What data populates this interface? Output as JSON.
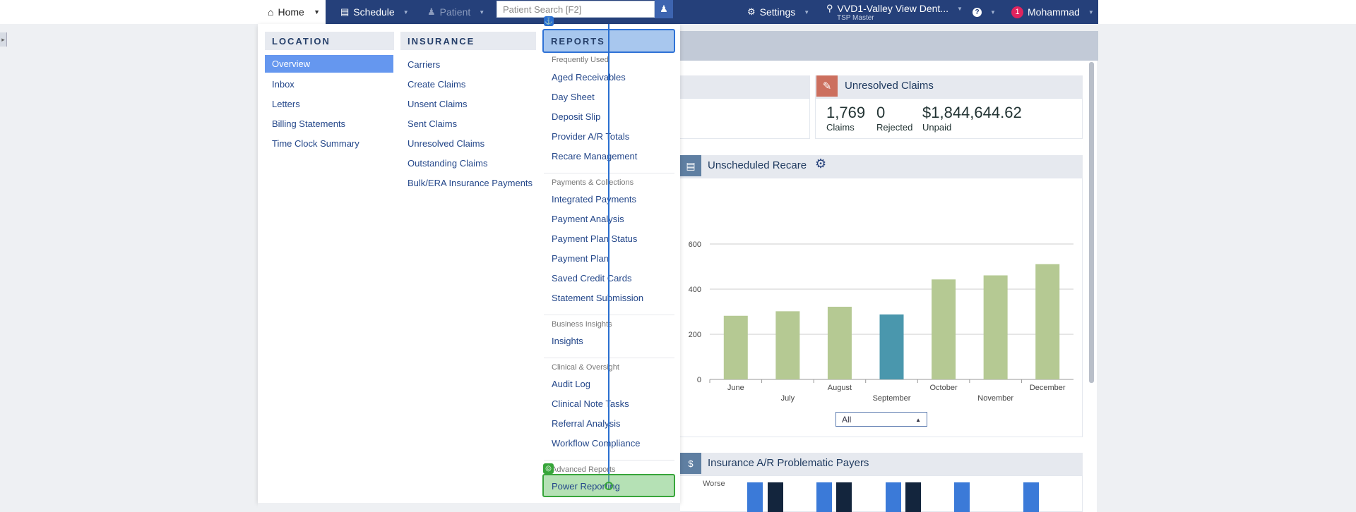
{
  "topbar": {
    "home_label": "Home",
    "schedule_label": "Schedule",
    "patient_label": "Patient",
    "search_placeholder": "Patient Search [F2]",
    "settings_label": "Settings",
    "location_label": "VVD1-Valley View Dent...",
    "location_sub": "TSP Master",
    "notification_count": "1",
    "user_label": "Mohammad"
  },
  "menu": {
    "location": {
      "header": "LOCATION",
      "items": [
        "Overview",
        "Inbox",
        "Letters",
        "Billing Statements",
        "Time Clock Summary"
      ]
    },
    "insurance": {
      "header": "INSURANCE",
      "items": [
        "Carriers",
        "Create Claims",
        "Unsent Claims",
        "Sent Claims",
        "Unresolved Claims",
        "Outstanding Claims",
        "Bulk/ERA Insurance Payments"
      ]
    },
    "reports": {
      "header": "REPORTS",
      "sections": [
        {
          "title": "Frequently Used",
          "items": [
            "Aged Receivables",
            "Day Sheet",
            "Deposit Slip",
            "Provider A/R Totals",
            "Recare Management"
          ]
        },
        {
          "title": "Payments & Collections",
          "items": [
            "Integrated Payments",
            "Payment Analysis",
            "Payment Plan Status",
            "Payment Plan",
            "Saved Credit Cards",
            "Statement Submission"
          ]
        },
        {
          "title": "Business Insights",
          "items": [
            "Insights"
          ]
        },
        {
          "title": "Clinical & Oversight",
          "items": [
            "Audit Log",
            "Clinical Note Tasks",
            "Referral Analysis",
            "Workflow Compliance"
          ]
        },
        {
          "title": "Advanced Reports",
          "items": [
            "Power Reporting"
          ]
        }
      ]
    }
  },
  "dashboard": {
    "unresolved_claims": {
      "title": "Unresolved Claims",
      "stats": [
        {
          "value": "1,769",
          "label": "Claims"
        },
        {
          "value": "0",
          "label": "Rejected"
        },
        {
          "value": "$1,844,644.62",
          "label": "Unpaid"
        }
      ]
    },
    "unscheduled_recare": {
      "title": "Unscheduled Recare",
      "filter_value": "All"
    },
    "insurance_ar": {
      "title": "Insurance A/R Problematic Payers",
      "axis_label": "Worse"
    }
  },
  "chart_data": {
    "type": "bar",
    "categories": [
      "June",
      "July",
      "August",
      "September",
      "October",
      "November",
      "December"
    ],
    "values": [
      282,
      302,
      322,
      288,
      443,
      461,
      511
    ],
    "highlight_index": 3,
    "ylim": [
      0,
      650
    ],
    "yticks": [
      0,
      200,
      400,
      600
    ],
    "colors": {
      "default": "#b5c993",
      "highlight": "#4a97ad"
    },
    "grid": true
  },
  "colors": {
    "nav_bg": "#25407a",
    "menu_selected": "#6597ef",
    "link": "#24478a",
    "annotation_blue": "#2a6fd0",
    "annotation_green": "#37a53a",
    "ip_bar_blue": "#3b7ad8",
    "ip_bar_navy": "#13253d"
  },
  "icons": {
    "home": "home-icon",
    "calendar": "calendar-icon",
    "person": "person-icon",
    "gear": "gear-icon",
    "location": "location-pin-icon",
    "help": "question-icon",
    "anchor": "anchor-icon",
    "target": "target-icon"
  }
}
